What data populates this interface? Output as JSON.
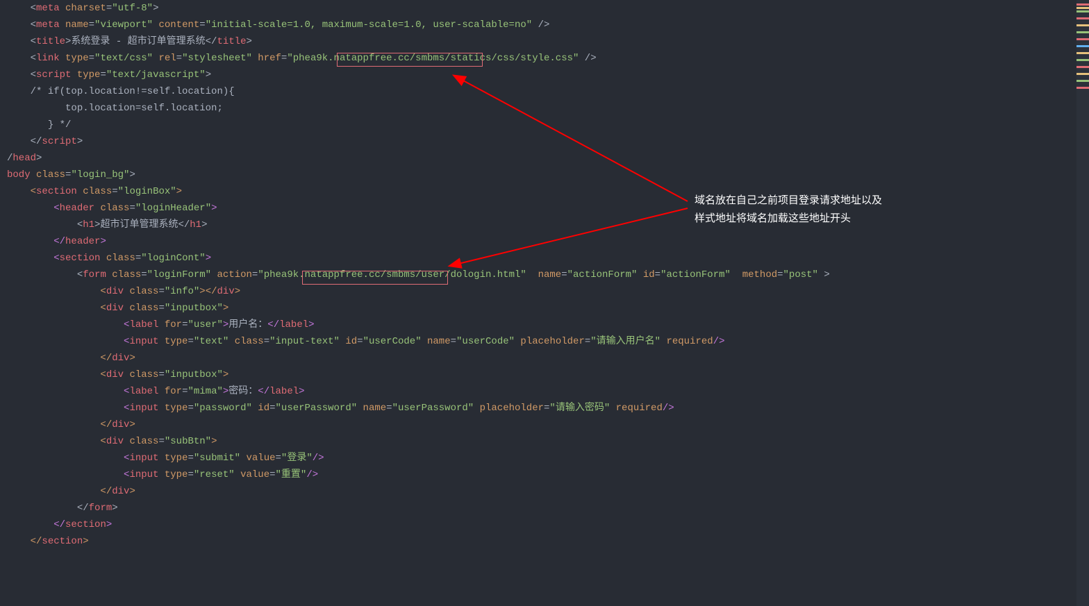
{
  "code": {
    "line1_tag_open": "<",
    "line1_tag": "meta",
    "line1_attr1": " charset",
    "line1_eq": "=",
    "line1_val1": "\"utf-8\"",
    "line1_close": ">",
    "line2_tag_open": "<",
    "line2_tag": "meta",
    "line2_attr1": " name",
    "line2_val1": "\"viewport\"",
    "line2_attr2": " content",
    "line2_val2": "\"initial-scale=1.0, maximum-scale=1.0, user-scalable=no\"",
    "line2_close": " />",
    "line3_open": "<",
    "line3_tag": "title",
    "line3_gt": ">",
    "line3_text": "系统登录 - 超市订单管理系统",
    "line3_close_open": "</",
    "line3_close": ">",
    "line4_open": "<",
    "line4_tag": "link",
    "line4_attr1": " type",
    "line4_val1": "\"text/css\"",
    "line4_attr2": " rel",
    "line4_val2": "\"stylesheet\"",
    "line4_attr3": " href",
    "line4_val3a": "\"",
    "line4_val3_hl": "phea9k.natappfree.cc",
    "line4_val3b": "/smbms/statics/css/style.css\"",
    "line4_close": " />",
    "line5_open": "<",
    "line5_tag": "script",
    "line5_attr1": " type",
    "line5_val1": "\"text/javascript\"",
    "line5_close": ">",
    "line6": "/* if(top.location!=self.location){",
    "line7": "      top.location=self.location;",
    "line8": "   } */",
    "line9_open": "</",
    "line9_tag": "script",
    "line9_close": ">",
    "line10_open": "/",
    "line10_tag": "head",
    "line10_close": ">",
    "line11_tag": "body",
    "line11_attr1": " class",
    "line11_val1": "\"login_bg\"",
    "line11_close": ">",
    "line12_open": "<",
    "line12_tag": "section",
    "line12_attr1": " class",
    "line12_val1": "\"loginBox\"",
    "line12_close": ">",
    "line13_open": "<",
    "line13_tag": "header",
    "line13_attr1": " class",
    "line13_val1": "\"loginHeader\"",
    "line13_close": ">",
    "line14_open": "<",
    "line14_tag": "h1",
    "line14_gt": ">",
    "line14_text": "超市订单管理系统",
    "line14_close_open": "</",
    "line14_close": ">",
    "line15_open": "</",
    "line15_tag": "header",
    "line15_close": ">",
    "line16_open": "<",
    "line16_tag": "section",
    "line16_attr1": " class",
    "line16_val1": "\"loginCont\"",
    "line16_close": ">",
    "line17_open": "<",
    "line17_tag": "form",
    "line17_attr1": " class",
    "line17_val1": "\"loginForm\"",
    "line17_attr2": " action",
    "line17_val2a": "\"",
    "line17_val2_hl": "phea9k.natappfree.cc",
    "line17_val2b": "/smbms/user/dologin.html\"",
    "line17_attr3": "  name",
    "line17_val3": "\"actionForm\"",
    "line17_attr4": " id",
    "line17_val4": "\"actionForm\"",
    "line17_attr5": "  method",
    "line17_val5": "\"post\"",
    "line17_close": " >",
    "line18_open": "<",
    "line18_tag": "div",
    "line18_attr1": " class",
    "line18_val1": "\"info\"",
    "line18_gt": ">",
    "line18_close_open": "</",
    "line18_close": ">",
    "line19_open": "<",
    "line19_tag": "div",
    "line19_attr1": " class",
    "line19_val1": "\"inputbox\"",
    "line19_close": ">",
    "line20_open": "<",
    "line20_tag": "label",
    "line20_attr1": " for",
    "line20_val1": "\"user\"",
    "line20_gt": ">",
    "line20_text": "用户名：",
    "line20_close_open": "</",
    "line20_close": ">",
    "line21_open": "<",
    "line21_tag": "input",
    "line21_attr1": " type",
    "line21_val1": "\"text\"",
    "line21_attr2": " class",
    "line21_val2": "\"input-text\"",
    "line21_attr3": " id",
    "line21_val3": "\"userCode\"",
    "line21_attr4": " name",
    "line21_val4": "\"userCode\"",
    "line21_attr5": " placeholder",
    "line21_val5": "\"请输入用户名\"",
    "line21_attr6": " required",
    "line21_close": "/>",
    "line22_open": "</",
    "line22_tag": "div",
    "line22_close": ">",
    "line23_open": "<",
    "line23_tag": "div",
    "line23_attr1": " class",
    "line23_val1": "\"inputbox\"",
    "line23_close": ">",
    "line24_open": "<",
    "line24_tag": "label",
    "line24_attr1": " for",
    "line24_val1": "\"mima\"",
    "line24_gt": ">",
    "line24_text": "密码：",
    "line24_close_open": "</",
    "line24_close": ">",
    "line25_open": "<",
    "line25_tag": "input",
    "line25_attr1": " type",
    "line25_val1": "\"password\"",
    "line25_attr2": " id",
    "line25_val2": "\"userPassword\"",
    "line25_attr3": " name",
    "line25_val3": "\"userPassword\"",
    "line25_attr4": " placeholder",
    "line25_val4": "\"请输入密码\"",
    "line25_attr5": " required",
    "line25_close": "/>",
    "line26_open": "</",
    "line26_tag": "div",
    "line26_close": ">",
    "line27_open": "<",
    "line27_tag": "div",
    "line27_attr1": " class",
    "line27_val1": "\"subBtn\"",
    "line27_close": ">",
    "line28_open": "<",
    "line28_tag": "input",
    "line28_attr1": " type",
    "line28_val1": "\"submit\"",
    "line28_attr2": " value",
    "line28_val2": "\"登录\"",
    "line28_close": "/>",
    "line29_open": "<",
    "line29_tag": "input",
    "line29_attr1": " type",
    "line29_val1": "\"reset\"",
    "line29_attr2": " value",
    "line29_val2": "\"重置\"",
    "line29_close": "/>",
    "line30_open": "</",
    "line30_tag": "div",
    "line30_close": ">",
    "line31_open": "</",
    "line31_tag": "form",
    "line31_close": ">",
    "line32_open": "</",
    "line32_tag": "section",
    "line32_close": ">",
    "line33_open": "</",
    "line33_tag": "section",
    "line33_close": ">"
  },
  "annotation": {
    "line1": "域名放在自己之前项目登录请求地址以及",
    "line2": "样式地址将域名加载这些地址开头"
  }
}
